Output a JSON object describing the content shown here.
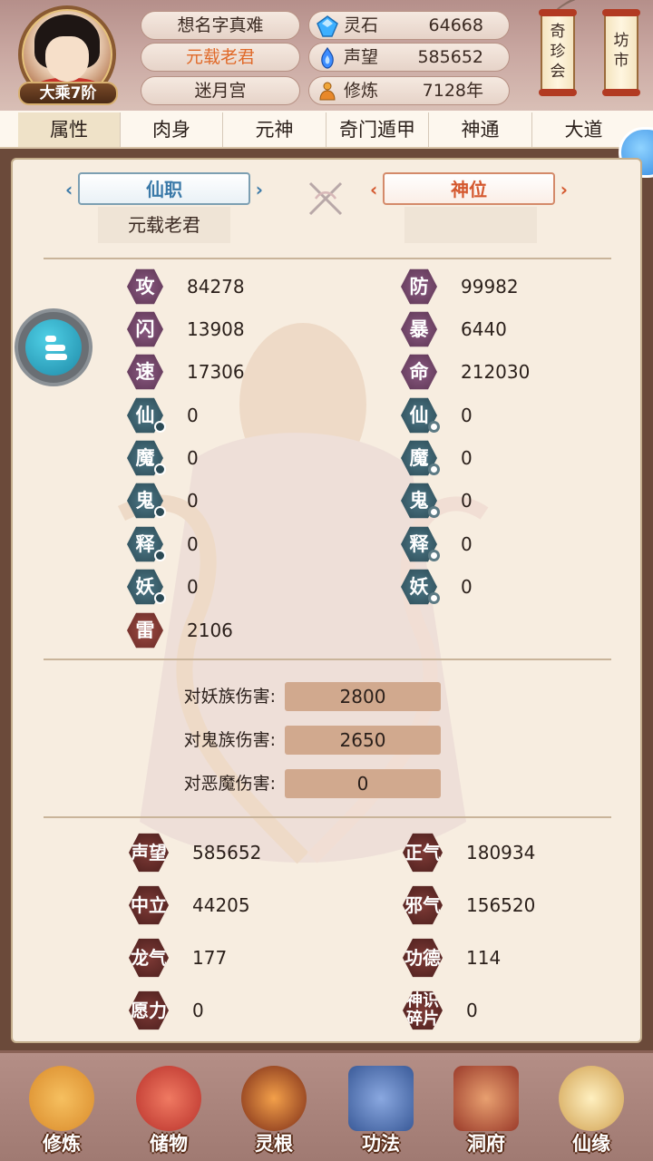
{
  "header": {
    "realm": "大乘7阶",
    "names": [
      "想名字真难",
      "元载老君",
      "迷月宫"
    ],
    "resources": [
      {
        "icon": "spirit-stone-icon",
        "label": "灵石",
        "value": "64668"
      },
      {
        "icon": "reputation-flame-icon",
        "label": "声望",
        "value": "585652"
      },
      {
        "icon": "cultivation-meditation-icon",
        "label": "修炼",
        "value": "7128年"
      }
    ],
    "buttons": [
      {
        "label": "奇珍会",
        "lines": [
          "奇",
          "珍",
          "会"
        ]
      },
      {
        "label": "坊市",
        "lines": [
          "坊",
          "市"
        ]
      }
    ],
    "accent_name_color": "#e06a2a"
  },
  "tabs": [
    "属性",
    "肉身",
    "元神",
    "奇门遁甲",
    "神通",
    "大道"
  ],
  "active_tab": "属性",
  "titles": {
    "xianzhi": {
      "label": "仙职",
      "value": "元载老君"
    },
    "shenwei": {
      "label": "神位",
      "value": ""
    }
  },
  "stats_left": [
    {
      "glyph": "攻",
      "value": "84278",
      "style": "purple"
    },
    {
      "glyph": "闪",
      "value": "13908",
      "style": "purple"
    },
    {
      "glyph": "速",
      "value": "17306",
      "style": "purple"
    },
    {
      "glyph": "仙",
      "value": "0",
      "style": "teal",
      "marker": "info"
    },
    {
      "glyph": "魔",
      "value": "0",
      "style": "teal",
      "marker": "info"
    },
    {
      "glyph": "鬼",
      "value": "0",
      "style": "teal",
      "marker": "info"
    },
    {
      "glyph": "释",
      "value": "0",
      "style": "teal",
      "marker": "info"
    },
    {
      "glyph": "妖",
      "value": "0",
      "style": "teal",
      "marker": "info"
    },
    {
      "glyph": "雷",
      "value": "2106",
      "style": "red"
    }
  ],
  "stats_right": [
    {
      "glyph": "防",
      "value": "99982",
      "style": "purple"
    },
    {
      "glyph": "暴",
      "value": "6440",
      "style": "purple"
    },
    {
      "glyph": "命",
      "value": "212030",
      "style": "purple"
    },
    {
      "glyph": "仙",
      "value": "0",
      "style": "teal",
      "marker": "ring"
    },
    {
      "glyph": "魔",
      "value": "0",
      "style": "teal",
      "marker": "ring"
    },
    {
      "glyph": "鬼",
      "value": "0",
      "style": "teal",
      "marker": "ring"
    },
    {
      "glyph": "释",
      "value": "0",
      "style": "teal",
      "marker": "ring"
    },
    {
      "glyph": "妖",
      "value": "0",
      "style": "teal",
      "marker": "ring"
    }
  ],
  "damage": [
    {
      "label": "对妖族伤害:",
      "value": "2800"
    },
    {
      "label": "对鬼族伤害:",
      "value": "2650"
    },
    {
      "label": "对恶魔伤害:",
      "value": "0"
    }
  ],
  "reputation_left": [
    {
      "label": "声望",
      "value": "585652"
    },
    {
      "label": "中立",
      "value": "44205"
    },
    {
      "label": "龙气",
      "value": "177"
    },
    {
      "label": "愿力",
      "value": "0"
    }
  ],
  "reputation_right": [
    {
      "label": "正气",
      "value": "180934"
    },
    {
      "label": "邪气",
      "value": "156520"
    },
    {
      "label": "功德",
      "value": "114"
    },
    {
      "label": "神识碎片",
      "lines": [
        "神识",
        "碎片"
      ],
      "value": "0"
    }
  ],
  "bottom_nav": [
    {
      "label": "修炼",
      "icon": "meditating-monk-icon",
      "color": "#d98a2a"
    },
    {
      "label": "储物",
      "icon": "treasure-bag-icon",
      "color": "#d0443a"
    },
    {
      "label": "灵根",
      "icon": "spirit-root-swirl-icon",
      "color": "#c8502a"
    },
    {
      "label": "功法",
      "icon": "technique-book-icon",
      "color": "#4a6aa8"
    },
    {
      "label": "洞府",
      "icon": "cave-mansion-icon",
      "color": "#b0463a"
    },
    {
      "label": "仙缘",
      "icon": "gourd-immortal-icon",
      "color": "#e0c070"
    }
  ]
}
